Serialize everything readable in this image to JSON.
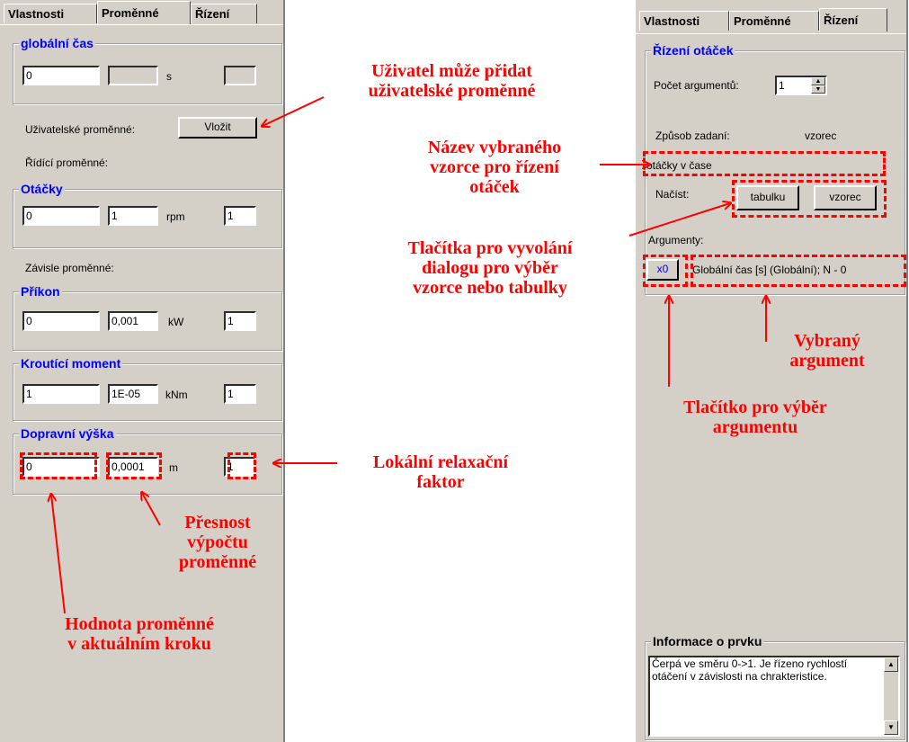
{
  "left_panel": {
    "tabs": [
      "Vlastnosti",
      "Proměnné",
      "Řízení"
    ],
    "global_time": {
      "legend": "globální čas",
      "value": "0",
      "unit": "s"
    },
    "user_vars_label": "Uživatelské proměnné:",
    "insert_button": "Vložit",
    "control_vars_label": "Řídící proměnné:",
    "otacky": {
      "legend": "Otáčky",
      "value": "0",
      "precision": "1",
      "unit": "rpm",
      "relax": "1"
    },
    "dependent_vars_label": "Závisle proměnné:",
    "prikon": {
      "legend": "Příkon",
      "value": "0",
      "precision": "0,001",
      "unit": "kW",
      "relax": "1"
    },
    "moment": {
      "legend": "Kroutící moment",
      "value": "1",
      "precision": "1E-05",
      "unit": "kNm",
      "relax": "1"
    },
    "vyska": {
      "legend": "Dopravní výška",
      "value": "0",
      "precision": "0,0001",
      "unit": "m",
      "relax": "1"
    }
  },
  "right_panel": {
    "tabs": [
      "Vlastnosti",
      "Proměnné",
      "Řízení"
    ],
    "group_legend": "Řízení otáček",
    "arg_count_label": "Počet argumentů:",
    "arg_count_value": "1",
    "input_mode_label": "Způsob zadaní:",
    "input_mode_value": "vzorec",
    "formula_name": "otáčky v čase",
    "load_label": "Načíst:",
    "table_button": "tabulku",
    "formula_button": "vzorec",
    "arguments_label": "Argumenty:",
    "arg_button": "x0",
    "arg_value": "Globální čas [s] (Globální); N - 0",
    "info_legend": "Informace o prvku",
    "info_text": "Čerpá ve směru 0->1. Je řízeno rychlostí otáčení v závislosti na chrakteristice."
  },
  "annotations": {
    "user_vars": "Uživatel může přidat\nuživatelské proměnné",
    "local_relax": "Lokální relaxační\nfaktor",
    "precision": "Přesnost\nvýpočtu\nproměnné",
    "value_step": "Hodnota proměnné\nv aktuálním kroku",
    "formula_name": "Název vybraného\nvzorce pro řízení\notáček",
    "buttons": "Tlačítka pro vyvolání\ndialogu pro výběr\nvzorce nebo tabulky",
    "selected_arg": "Vybraný\nargument",
    "arg_button": "Tlačítko pro výběr\nargumentu"
  },
  "colors": {
    "panel": "#d4d0c8",
    "legend_blue": "#0000ff",
    "annotation_red": "#ff0000"
  }
}
